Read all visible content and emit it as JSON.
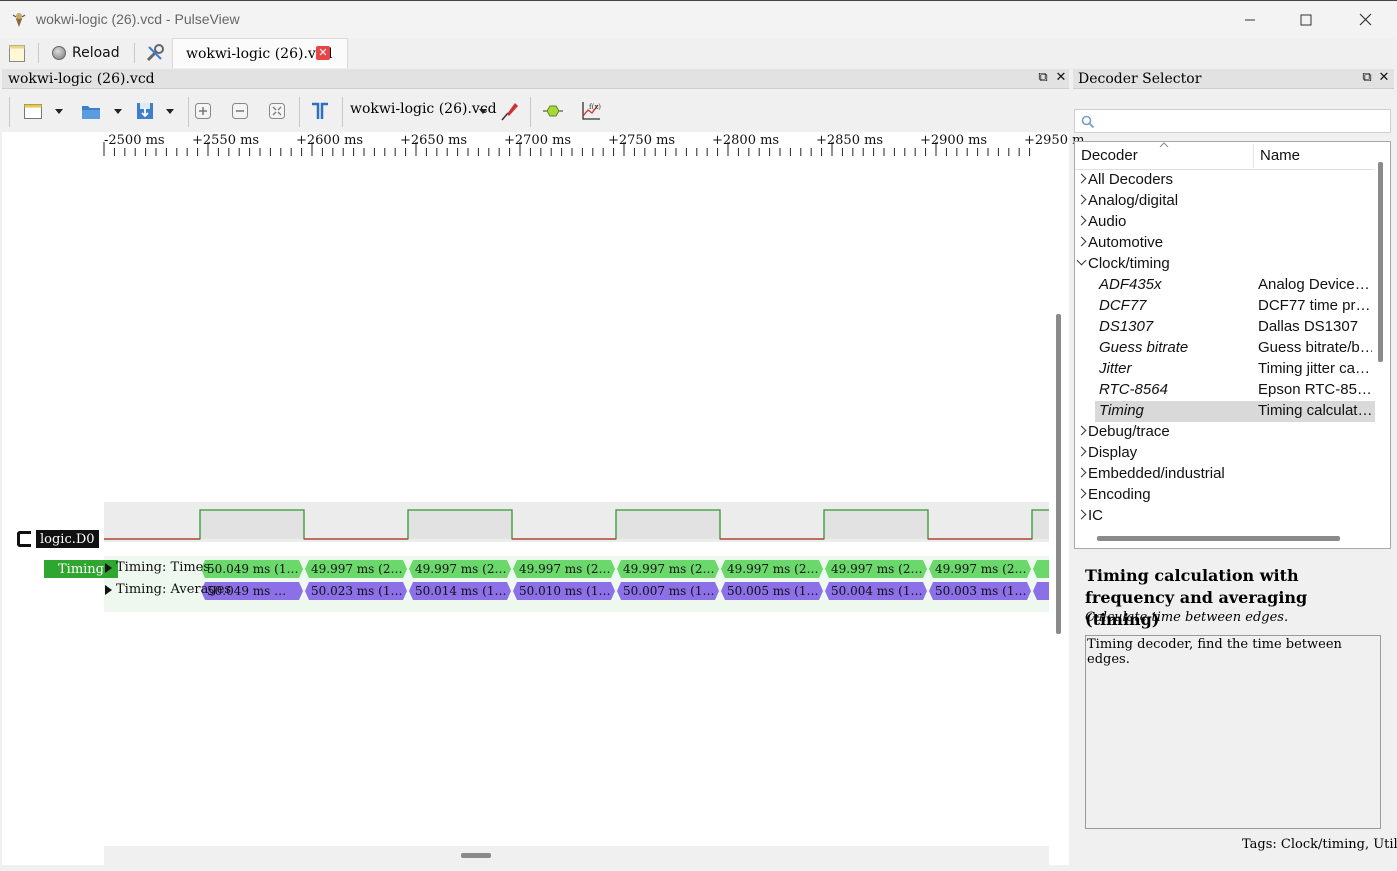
{
  "window": {
    "title": "wokwi-logic (26).vcd - PulseView"
  },
  "toolbar": {
    "reload_label": "Reload",
    "tab_label": "wokwi-logic (26).vcd"
  },
  "view": {
    "dock_title": "wokwi-logic (26).vcd",
    "device_select": "wokwi-logic (26).vcd"
  },
  "ruler": {
    "labels": [
      "-2500 ms",
      "+2550 ms",
      "+2600 ms",
      "+2650 ms",
      "+2700 ms",
      "+2750 ms",
      "+2800 ms",
      "+2850 ms",
      "+2900 ms",
      "+2950 m"
    ]
  },
  "trace": {
    "channel_label": "logic.D0",
    "decoder_label": "Timing",
    "rows": [
      {
        "title": "Timing: Times",
        "color": "#6bd86b",
        "annotations": [
          "50.049 ms (1…",
          "49.997 ms (2…",
          "49.997 ms (2…",
          "49.997 ms (2…",
          "49.997 ms (2…",
          "49.997 ms (2…",
          "49.997 ms (2…",
          "49.997 ms (2…"
        ]
      },
      {
        "title": "Timing: Averages",
        "color": "#8b70e8",
        "annotations": [
          "50.049 ms …",
          "50.023 ms (1…",
          "50.014 ms (1…",
          "50.010 ms (1…",
          "50.007 ms (1…",
          "50.005 ms (1…",
          "50.004 ms (1…",
          "50.003 ms (1…"
        ]
      }
    ]
  },
  "decoder_selector": {
    "dock_title": "Decoder Selector",
    "search_placeholder": "",
    "columns": [
      "Decoder",
      "Name"
    ],
    "tree": [
      {
        "label": "All Decoders",
        "type": "group",
        "expanded": false
      },
      {
        "label": "Analog/digital",
        "type": "group",
        "expanded": false
      },
      {
        "label": "Audio",
        "type": "group",
        "expanded": false
      },
      {
        "label": "Automotive",
        "type": "group",
        "expanded": false
      },
      {
        "label": "Clock/timing",
        "type": "group",
        "expanded": true
      },
      {
        "label": "ADF435x",
        "name": "Analog Device…",
        "type": "child"
      },
      {
        "label": "DCF77",
        "name": "DCF77 time pr…",
        "type": "child"
      },
      {
        "label": "DS1307",
        "name": "Dallas DS1307",
        "type": "child"
      },
      {
        "label": "Guess bitrate",
        "name": "Guess bitrate/b…",
        "type": "child"
      },
      {
        "label": "Jitter",
        "name": "Timing jitter ca…",
        "type": "child"
      },
      {
        "label": "RTC-8564",
        "name": "Epson RTC-85…",
        "type": "child"
      },
      {
        "label": "Timing",
        "name": "Timing calculat…",
        "type": "child",
        "selected": true
      },
      {
        "label": "Debug/trace",
        "type": "group",
        "expanded": false
      },
      {
        "label": "Display",
        "type": "group",
        "expanded": false
      },
      {
        "label": "Embedded/industrial",
        "type": "group",
        "expanded": false
      },
      {
        "label": "Encoding",
        "type": "group",
        "expanded": false
      },
      {
        "label": "IC",
        "type": "group",
        "expanded": false
      }
    ],
    "info_title": "Timing calculation with frequency and averaging (timing)",
    "info_subtitle": "Calculate time between edges.",
    "info_description": "Timing decoder, find the time between edges.",
    "info_tags": "Tags: Clock/timing, Util"
  }
}
